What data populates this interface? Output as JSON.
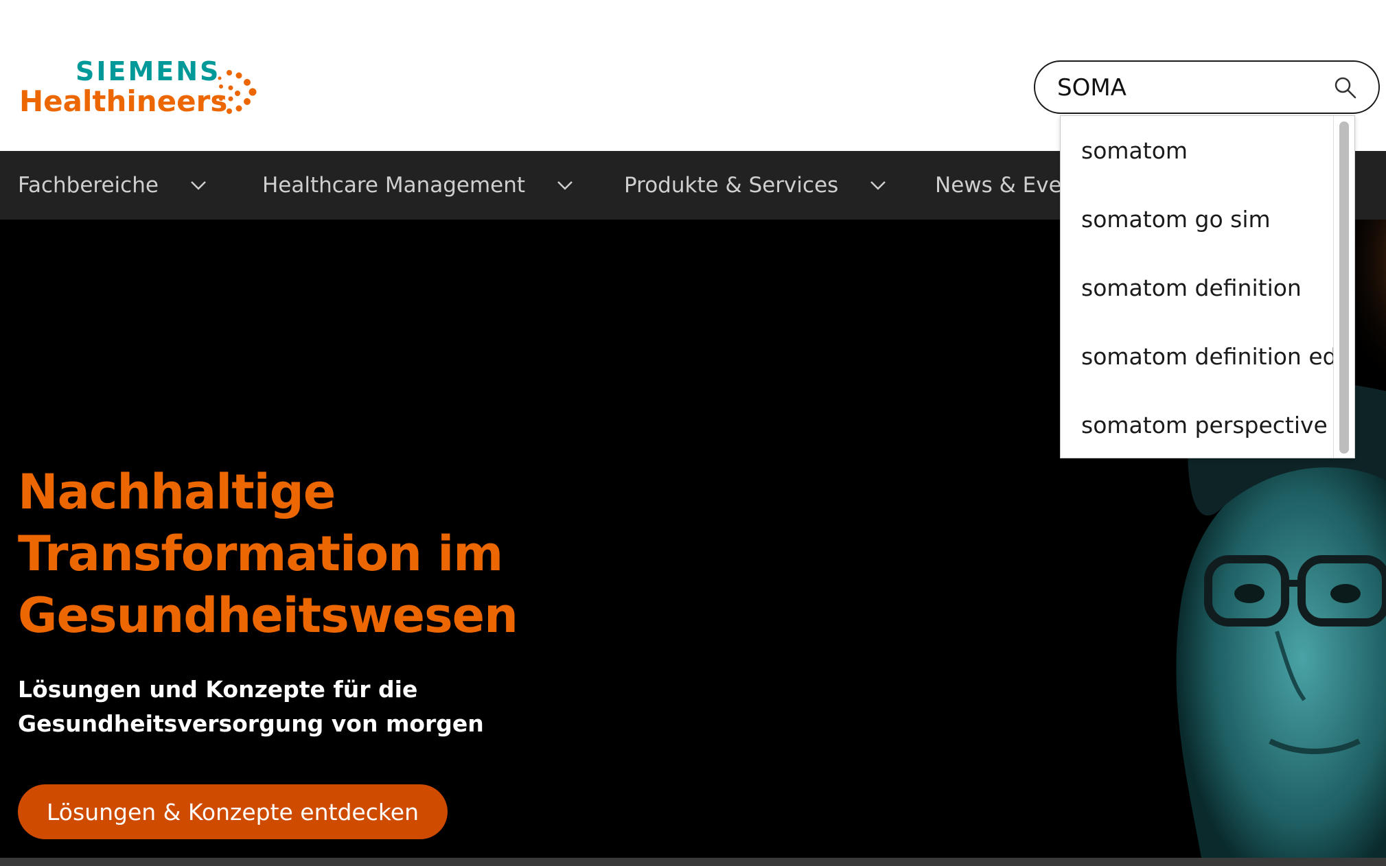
{
  "brand": {
    "line1": "SIEMENS",
    "line2": "Healthineers",
    "primary": "#009999",
    "accent": "#ec6602"
  },
  "search": {
    "value": "SOMA",
    "icon": "search-icon"
  },
  "nav": {
    "items": [
      {
        "label": "Fachbereiche"
      },
      {
        "label": "Healthcare Management"
      },
      {
        "label": "Produkte & Services"
      },
      {
        "label": "News & Even"
      }
    ]
  },
  "suggestions": [
    "somatom",
    "somatom go sim",
    "somatom definition",
    "somatom definition edge",
    "somatom perspective"
  ],
  "hero": {
    "title_lines": [
      "Nachhaltige",
      "Transformation im",
      "Gesundheitswesen"
    ],
    "subtitle_lines": [
      "Lösungen und Konzepte für die",
      "Gesundheitsversorgung von morgen"
    ],
    "cta": "Lösungen & Konzepte entdecken",
    "colors": {
      "title": "#ec6602",
      "cta_bg": "#cf4b00",
      "background": "#000000"
    }
  }
}
